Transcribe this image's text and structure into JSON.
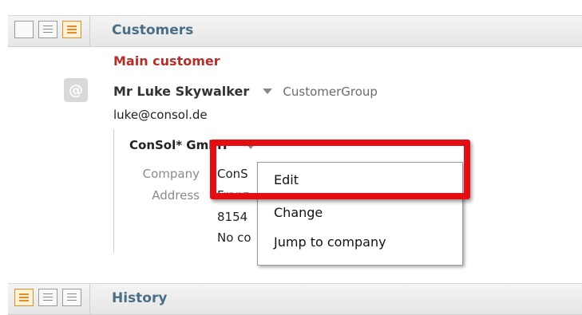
{
  "customers_section": {
    "title": "Customers"
  },
  "main_customer": {
    "label": "Main customer",
    "name": "Mr Luke Skywalker",
    "group": "CustomerGroup",
    "email": "luke@consol.de"
  },
  "company": {
    "name": "ConSol* GmbH",
    "fields": {
      "company_label": "Company",
      "company_value": "ConS",
      "address_label": "Address",
      "address_line1": "Franz",
      "address_line2": "8154",
      "address_line3": "No co"
    }
  },
  "context_menu": {
    "items": [
      "Edit",
      "Change",
      "Jump to company"
    ]
  },
  "history_section": {
    "title": "History"
  },
  "icons": {
    "email": "at-icon",
    "view_toggle": "list-view-icon"
  },
  "colors": {
    "section_title": "#4a6e86",
    "main_customer_label": "#b2302a",
    "highlight": "#e40d12",
    "active_view": "#e08c2a"
  }
}
